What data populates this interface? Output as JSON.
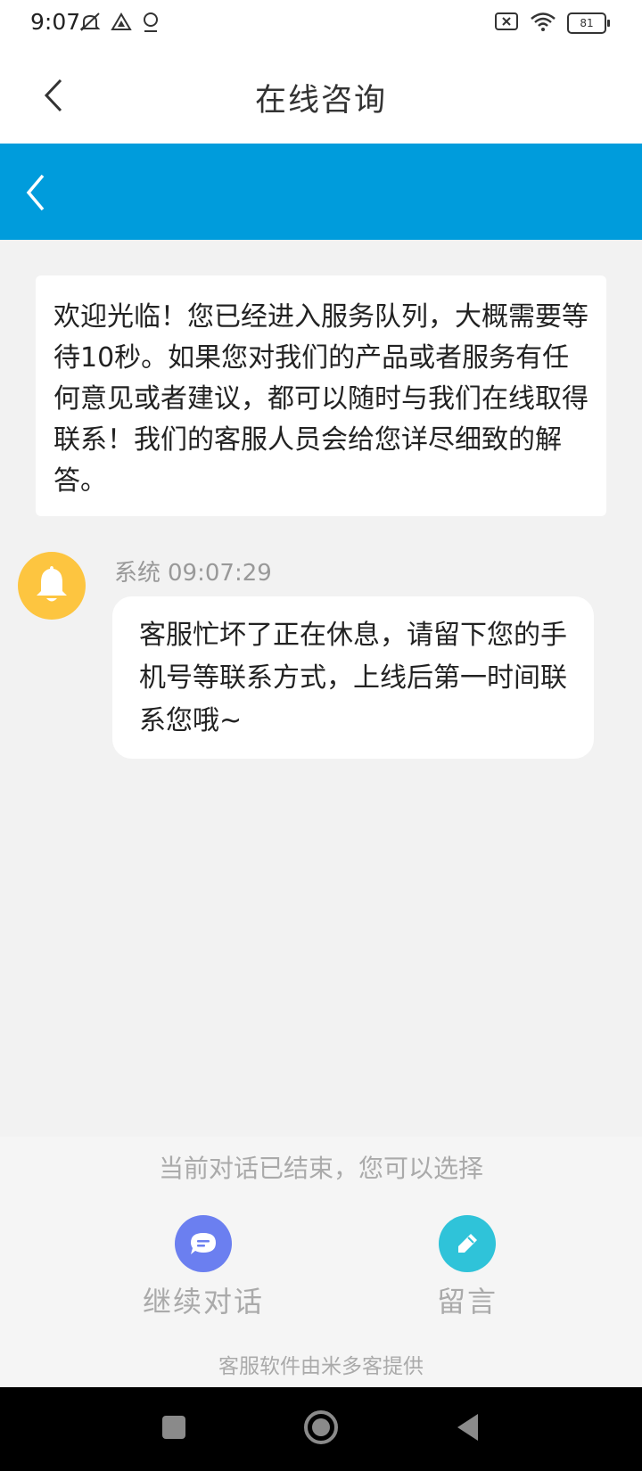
{
  "status_bar": {
    "time": "9:07",
    "battery": "81",
    "icons": [
      "mute-icon",
      "drive-icon",
      "location-icon",
      "sim-x-icon",
      "wifi-icon",
      "battery-icon"
    ]
  },
  "header": {
    "title": "在线咨询",
    "back_icon": "chevron-left-icon"
  },
  "blue_bar": {
    "back_icon": "chevron-left-icon",
    "color": "#009cdc"
  },
  "welcome": {
    "text": "欢迎光临！您已经进入服务队列，大概需要等待10秒。如果您对我们的产品或者服务有任何意见或者建议，都可以随时与我们在线取得联系！我们的客服人员会给您详尽细致的解答。"
  },
  "message": {
    "sender": "系统",
    "time": "09:07:29",
    "text": "客服忙坏了正在休息，请留下您的手机号等联系方式，上线后第一时间联系您哦~",
    "avatar_icon": "bell-icon",
    "avatar_color": "#fdc540"
  },
  "bottom": {
    "ended_text": "当前对话已结束，您可以选择",
    "continue_label": "继续对话",
    "continue_icon": "chat-bubble-icon",
    "continue_color": "#6b7ff0",
    "leave_label": "留言",
    "leave_icon": "pencil-icon",
    "leave_color": "#2fc3d9",
    "powered_by": "客服软件由米多客提供"
  },
  "nav": {
    "icons": [
      "recent-apps-icon",
      "home-icon",
      "back-icon"
    ]
  }
}
